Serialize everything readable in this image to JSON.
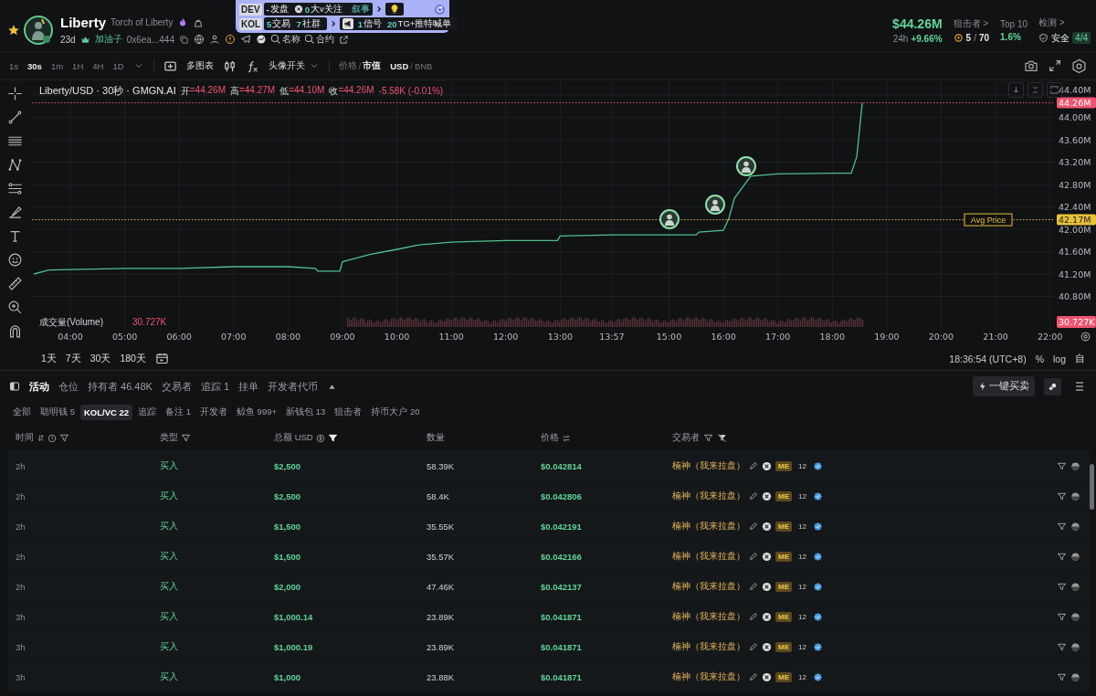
{
  "header": {
    "starred": true,
    "token": {
      "name": "Liberty",
      "subtitle": "Torch of Liberty",
      "age": "23d",
      "creator": "加油子",
      "address": "0x6ea...444",
      "links": [
        {
          "label": "名称"
        },
        {
          "label": "合约"
        }
      ]
    },
    "overlay": {
      "dev": {
        "tag": "DEV",
        "items": [
          {
            "count": "-",
            "text": "发盘",
            "kind": "plain"
          },
          {
            "count": "0",
            "text": "大v关注",
            "kind": "muted"
          }
        ],
        "narrative": "叙事"
      },
      "kol": {
        "tag": "KOL",
        "items": [
          {
            "count": "5",
            "text": "交易"
          },
          {
            "count": "7",
            "text": "社群"
          }
        ],
        "signals": [
          {
            "count": "1",
            "text": "信号"
          },
          {
            "count": "20",
            "text": "TG+推特喊单"
          }
        ]
      }
    },
    "stats": {
      "market_cap": "$44.26M",
      "change_label": "24h",
      "change": "+9.66%",
      "snipers": {
        "label": "狙击者 >",
        "count": "5",
        "separator": "/",
        "total": "70"
      },
      "top10": {
        "label": "Top 10",
        "value": "1.6%"
      },
      "audit": {
        "label": "检测 >",
        "value": "安全",
        "badge": "4/4"
      }
    }
  },
  "toolbar": {
    "intervals": [
      {
        "label": "1s",
        "selected": false
      },
      {
        "label": "30s",
        "selected": true
      },
      {
        "label": "1m",
        "selected": false
      },
      {
        "label": "1H",
        "selected": false
      },
      {
        "label": "4H",
        "selected": false
      },
      {
        "label": "1D",
        "selected": false
      }
    ],
    "multi_chart": "多图表",
    "avatar_toggle": "头像开关",
    "price_mode": {
      "separator": "/",
      "options": [
        {
          "label": "价格",
          "selected": false
        },
        {
          "label": "市值",
          "selected": true
        }
      ]
    },
    "currency": {
      "separator": "/",
      "options": [
        {
          "label": "USD",
          "selected": true
        },
        {
          "label": "BNB",
          "selected": false
        }
      ]
    }
  },
  "chart": {
    "legend": {
      "title": "Liberty/USD · 30秒 · GMGN.AI",
      "ohlc": [
        {
          "label": "开",
          "value": "=44.26M"
        },
        {
          "label": "高",
          "value": "=44.27M"
        },
        {
          "label": "低",
          "value": "=44.10M"
        },
        {
          "label": "收",
          "value": "=44.26M"
        }
      ],
      "change": "-5.58K (-0.01%)"
    },
    "volume": {
      "label": "成交量(Volume)",
      "value": "30.727K",
      "tag": "30.727K"
    },
    "chart_data": {
      "type": "line",
      "grid": true,
      "x": [
        3.33,
        3.6,
        4,
        5,
        6,
        7,
        8,
        8.5,
        8.55,
        8.95,
        9.0,
        9.5,
        10,
        10.4,
        11,
        12,
        12.95,
        13.0,
        14,
        15,
        15.5,
        15.55,
        16,
        16.1,
        16.2,
        16.5,
        17,
        18,
        18.35,
        18.45,
        18.55
      ],
      "series": [
        {
          "color": "#4fc08d",
          "values": [
            41.2,
            41.27,
            41.28,
            41.3,
            41.3,
            41.33,
            41.33,
            41.3,
            41.25,
            41.25,
            41.42,
            41.55,
            41.64,
            41.72,
            41.77,
            41.8,
            41.8,
            41.88,
            41.9,
            41.9,
            41.9,
            41.95,
            41.98,
            42.2,
            42.55,
            42.95,
            42.99,
            43.0,
            43.0,
            43.3,
            44.26
          ]
        }
      ],
      "xlim": [
        3.295,
        22.09
      ],
      "ylim": [
        40.8,
        44.4
      ],
      "xticks": [
        {
          "value": 4,
          "label": "04:00"
        },
        {
          "value": 5,
          "label": "05:00"
        },
        {
          "value": 6,
          "label": "06:00"
        },
        {
          "value": 7,
          "label": "07:00"
        },
        {
          "value": 8,
          "label": "08:00"
        },
        {
          "value": 9,
          "label": "09:00"
        },
        {
          "value": 10,
          "label": "10:00"
        },
        {
          "value": 11,
          "label": "11:00"
        },
        {
          "value": 12,
          "label": "12:00"
        },
        {
          "value": 13,
          "label": "13:00"
        },
        {
          "value": 13.95,
          "label": "13:57"
        },
        {
          "value": 15,
          "label": "15:00"
        },
        {
          "value": 16,
          "label": "16:00"
        },
        {
          "value": 17,
          "label": "17:00"
        },
        {
          "value": 18,
          "label": "18:00"
        },
        {
          "value": 19,
          "label": "19:00"
        },
        {
          "value": 20,
          "label": "20:00"
        },
        {
          "value": 21,
          "label": "21:00"
        },
        {
          "value": 22,
          "label": "22:00"
        }
      ],
      "yticks": [
        {
          "value": 44.4,
          "label": "44.40M"
        },
        {
          "value": 44.0,
          "label": "44.00M"
        },
        {
          "value": 43.6,
          "label": "43.60M"
        },
        {
          "value": 43.2,
          "label": "43.20M"
        },
        {
          "value": 42.8,
          "label": "42.80M"
        },
        {
          "value": 42.4,
          "label": "42.40M"
        },
        {
          "value": 42.0,
          "label": "42.00M"
        },
        {
          "value": 41.6,
          "label": "41.60M"
        },
        {
          "value": 41.2,
          "label": "41.20M"
        },
        {
          "value": 40.8,
          "label": "40.80M"
        }
      ],
      "ref_lines": [
        {
          "axis": "y",
          "value": 44.26,
          "label": "44.26M",
          "color": "#ef5470"
        },
        {
          "axis": "y",
          "value": 42.17,
          "label": "42.17M",
          "color": "#e6c13a"
        }
      ],
      "annotations": [
        "Avg Price"
      ]
    }
  },
  "range_bar": {
    "ranges": [
      "1天",
      "7天",
      "30天",
      "180天"
    ],
    "clock": "18:36:54 (UTC+8)",
    "scale_options": [
      "%",
      "log",
      "自"
    ]
  },
  "panel": {
    "tabs": [
      {
        "label": "活动",
        "selected": true
      },
      {
        "label": "仓位",
        "selected": false
      },
      {
        "label": "持有者 46.48K",
        "selected": false
      },
      {
        "label": "交易者",
        "selected": false
      },
      {
        "label": "追踪 1",
        "selected": false
      },
      {
        "label": "挂单",
        "selected": false
      },
      {
        "label": "开发者代币",
        "selected": false
      }
    ],
    "quick_trade": "一键买卖",
    "filters": [
      {
        "label": "全部",
        "selected": false
      },
      {
        "label": "聪明钱 5",
        "selected": false
      },
      {
        "label": "KOL/VC 22",
        "selected": true
      },
      {
        "label": "追踪",
        "selected": false
      },
      {
        "label": "备注 1",
        "selected": false
      },
      {
        "label": "开发者",
        "selected": false
      },
      {
        "label": "鲸鱼 999+",
        "selected": false
      },
      {
        "label": "新钱包 13",
        "selected": false
      },
      {
        "label": "狙击者",
        "selected": false
      },
      {
        "label": "持币大户 20",
        "selected": false
      }
    ],
    "columns": [
      {
        "label": "时间",
        "kind": "time"
      },
      {
        "label": "类型",
        "kind": "type"
      },
      {
        "label": "总额 USD",
        "kind": "amount",
        "filter_active": true
      },
      {
        "label": "数量",
        "kind": "quantity"
      },
      {
        "label": "价格",
        "kind": "price"
      },
      {
        "label": "交易者",
        "kind": "trader"
      }
    ],
    "rows": [
      {
        "time": "2h",
        "type": "买入",
        "total": "$2,500",
        "quantity": "58.39K",
        "price": "$0.042814",
        "trader": "楠神（我来拉盘）",
        "badges": [
          "ME",
          "12"
        ]
      },
      {
        "time": "2h",
        "type": "买入",
        "total": "$2,500",
        "quantity": "58.4K",
        "price": "$0.042806",
        "trader": "楠神（我来拉盘）",
        "badges": [
          "ME",
          "12"
        ]
      },
      {
        "time": "2h",
        "type": "买入",
        "total": "$1,500",
        "quantity": "35.55K",
        "price": "$0.042191",
        "trader": "楠神（我来拉盘）",
        "badges": [
          "ME",
          "12"
        ]
      },
      {
        "time": "2h",
        "type": "买入",
        "total": "$1,500",
        "quantity": "35.57K",
        "price": "$0.042166",
        "trader": "楠神（我来拉盘）",
        "badges": [
          "ME",
          "12"
        ]
      },
      {
        "time": "2h",
        "type": "买入",
        "total": "$2,000",
        "quantity": "47.46K",
        "price": "$0.042137",
        "trader": "楠神（我来拉盘）",
        "badges": [
          "ME",
          "12"
        ]
      },
      {
        "time": "3h",
        "type": "买入",
        "total": "$1,000.14",
        "quantity": "23.89K",
        "price": "$0.041871",
        "trader": "楠神（我来拉盘）",
        "badges": [
          "ME",
          "12"
        ]
      },
      {
        "time": "3h",
        "type": "买入",
        "total": "$1,000.19",
        "quantity": "23.89K",
        "price": "$0.041871",
        "trader": "楠神（我来拉盘）",
        "badges": [
          "ME",
          "12"
        ]
      },
      {
        "time": "3h",
        "type": "买入",
        "total": "$1,000",
        "quantity": "23.88K",
        "price": "$0.041871",
        "trader": "楠神（我来拉盘）",
        "badges": [
          "ME",
          "12"
        ]
      }
    ]
  }
}
